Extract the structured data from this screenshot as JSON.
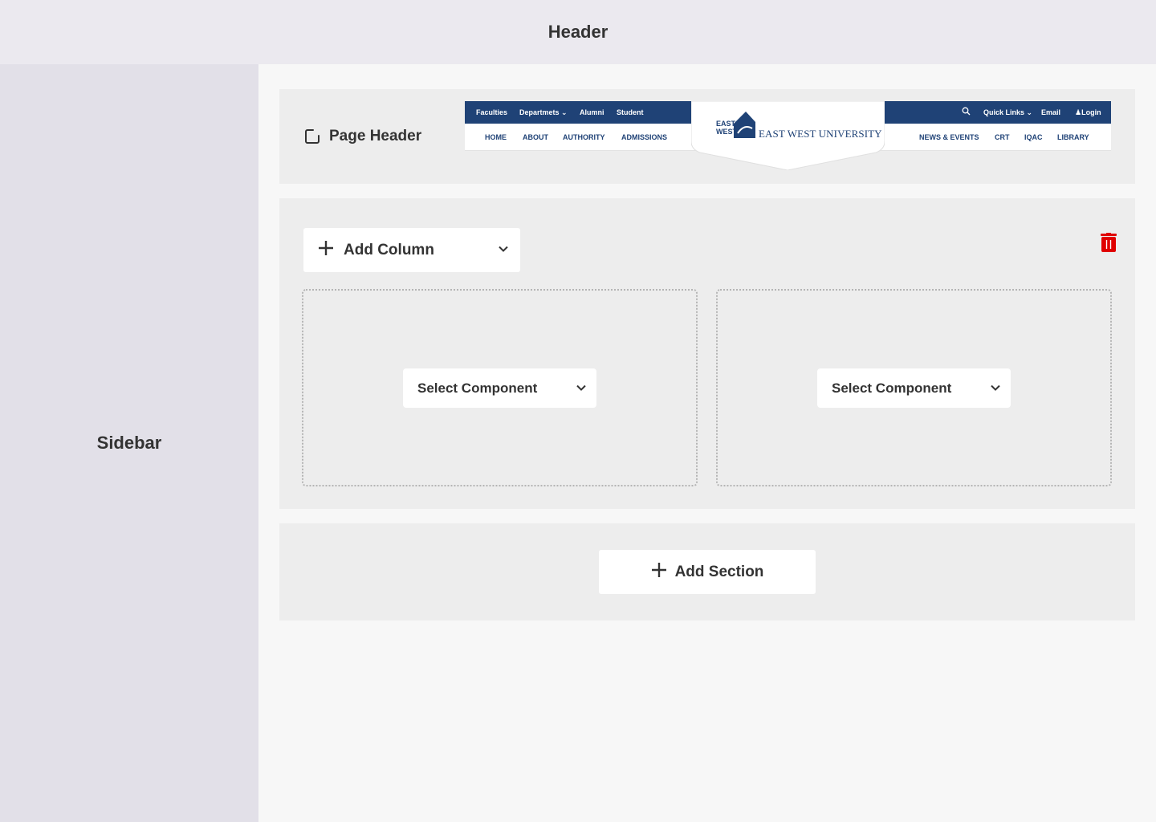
{
  "header": {
    "label": "Header"
  },
  "sidebar": {
    "label": "Sidebar"
  },
  "page_header_section": {
    "label": "Page Header",
    "icon": "square-corner-icon",
    "preview": {
      "top_links": [
        "Faculties",
        "Departmets",
        "Alumni",
        "Student"
      ],
      "top_right_links": [
        "Quick Links",
        "Email",
        "Login"
      ],
      "nav_left": [
        "HOME",
        "ABOUT",
        "AUTHORITY",
        "ADMISSIONS"
      ],
      "nav_right": [
        "NEWS & EVENTS",
        "CRT",
        "IQAC",
        "LIBRARY"
      ],
      "logo_mark": "EAST WEST",
      "logo_text": "EAST WEST UNIVERSITY",
      "colors": {
        "brand": "#1f4276"
      }
    }
  },
  "row_section": {
    "add_column_label": "Add Column",
    "delete_icon_color": "#e00000",
    "columns": [
      {
        "select_label": "Select Component"
      },
      {
        "select_label": "Select Component"
      }
    ]
  },
  "add_section": {
    "label": "Add Section"
  }
}
